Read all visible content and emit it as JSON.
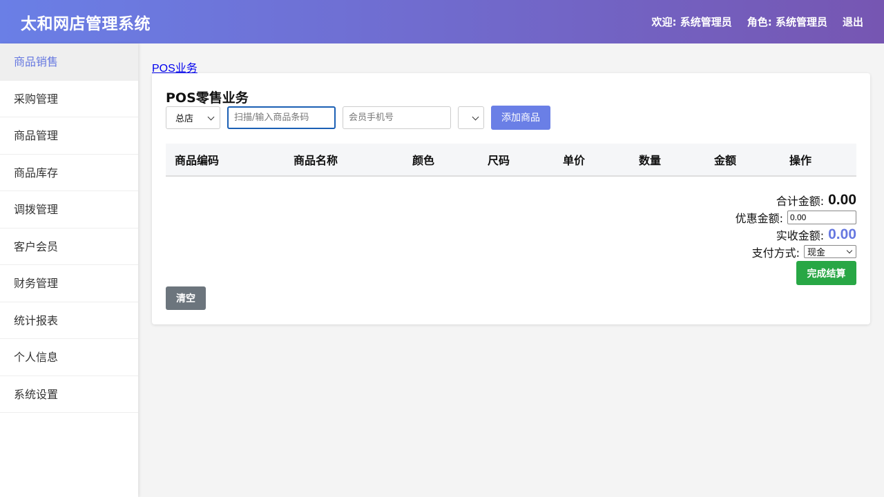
{
  "header": {
    "app_title": "太和网店管理系统",
    "welcome": "欢迎: 系统管理员",
    "role": "角色: 系统管理员",
    "logout": "退出"
  },
  "sidebar": {
    "items": [
      {
        "label": "商品销售",
        "active": true
      },
      {
        "label": "采购管理"
      },
      {
        "label": "商品管理"
      },
      {
        "label": "商品库存"
      },
      {
        "label": "调拨管理"
      },
      {
        "label": "客户会员"
      },
      {
        "label": "财务管理"
      },
      {
        "label": "统计报表"
      },
      {
        "label": "个人信息"
      },
      {
        "label": "系统设置"
      }
    ]
  },
  "main": {
    "breadcrumb": "POS业务",
    "title": "POS零售业务",
    "toolbar": {
      "store_select": "总店",
      "barcode_placeholder": "扫描/输入商品条码",
      "member_placeholder": "会员手机号",
      "extra_select": "",
      "add_button": "添加商品"
    },
    "table": {
      "columns": [
        "商品编码",
        "商品名称",
        "颜色",
        "尺码",
        "单价",
        "数量",
        "金额",
        "操作"
      ],
      "rows": []
    },
    "summary": {
      "total_label": "合计金额:",
      "total_value": "0.00",
      "discount_label": "优惠金额:",
      "discount_value": "0.00",
      "received_label": "实收金额:",
      "received_value": "0.00",
      "payment_label": "支付方式:",
      "payment_value": "现金"
    },
    "buttons": {
      "checkout": "完成结算",
      "clear": "清空"
    }
  },
  "colors": {
    "accent": "#6a7fe6",
    "success": "#28a745",
    "secondary": "#6c757d",
    "header_end": "#7656b2"
  }
}
